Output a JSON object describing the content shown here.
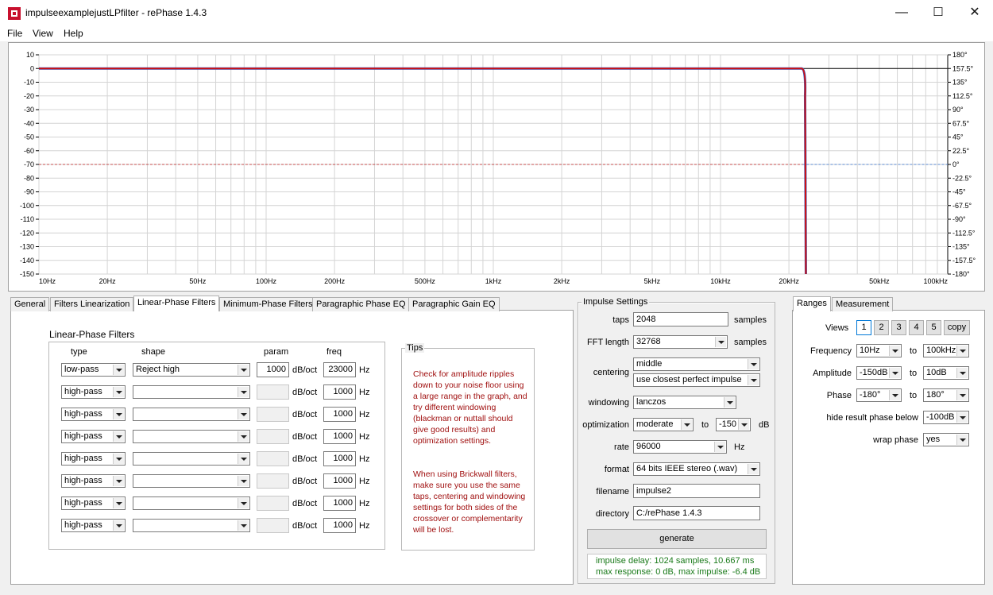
{
  "window": {
    "title": "impulseexamplejustLPfilter  -  rePhase 1.4.3",
    "minimize": "—",
    "maximize": "☐",
    "close": "✕"
  },
  "menu": [
    "File",
    "View",
    "Help"
  ],
  "graph": {
    "y_left_ticks": [
      "10",
      "0",
      "-10",
      "-20",
      "-30",
      "-40",
      "-50",
      "-60",
      "-70",
      "-80",
      "-90",
      "-100",
      "-110",
      "-120",
      "-130",
      "-140",
      "-150"
    ],
    "y_right_ticks": [
      "180°",
      "157.5°",
      "135°",
      "112.5°",
      "90°",
      "67.5°",
      "45°",
      "22.5°",
      "0°",
      "-22.5°",
      "-45°",
      "-67.5°",
      "-90°",
      "-112.5°",
      "-135°",
      "-157.5°",
      "-180°"
    ],
    "x_ticks": [
      "10Hz",
      "20Hz",
      "50Hz",
      "100Hz",
      "200Hz",
      "500Hz",
      "1kHz",
      "2kHz",
      "5kHz",
      "10kHz",
      "20kHz",
      "50kHz",
      "100kHz"
    ],
    "cutoff_hz": 23000,
    "curve_color": "#d01010",
    "phase_color": "#3060d0",
    "threshold_db": -70
  },
  "tabs": [
    "General",
    "Filters Linearization",
    "Linear-Phase Filters",
    "Minimum-Phase Filters",
    "Paragraphic Phase EQ",
    "Paragraphic Gain EQ"
  ],
  "lpf": {
    "heading": "Linear-Phase Filters",
    "col_type": "type",
    "col_shape": "shape",
    "col_param": "param",
    "col_freq": "freq",
    "unit_param": "dB/oct",
    "unit_freq": "Hz",
    "rows": [
      {
        "type": "low-pass",
        "shape": "Reject high",
        "param": "1000",
        "freq": "23000"
      },
      {
        "type": "high-pass",
        "shape": "",
        "param": "",
        "freq": "1000"
      },
      {
        "type": "high-pass",
        "shape": "",
        "param": "",
        "freq": "1000"
      },
      {
        "type": "high-pass",
        "shape": "",
        "param": "",
        "freq": "1000"
      },
      {
        "type": "high-pass",
        "shape": "",
        "param": "",
        "freq": "1000"
      },
      {
        "type": "high-pass",
        "shape": "",
        "param": "",
        "freq": "1000"
      },
      {
        "type": "high-pass",
        "shape": "",
        "param": "",
        "freq": "1000"
      },
      {
        "type": "high-pass",
        "shape": "",
        "param": "",
        "freq": "1000"
      }
    ]
  },
  "tips": {
    "title": "Tips",
    "p1": "Check for amplitude ripples down to your noise floor using a large range in the graph, and try different windowing (blackman or nuttall should give good results) and optimization settings.",
    "p2": "When using Brickwall filters, make sure you use the same taps, centering and windowing settings for both sides of the crossover or complementarity will be lost."
  },
  "impulse": {
    "title": "Impulse Settings",
    "taps_label": "taps",
    "taps_value": "2048",
    "taps_unit": "samples",
    "fft_label": "FFT length",
    "fft_value": "32768",
    "fft_unit": "samples",
    "centering_label": "centering",
    "centering_value": "middle",
    "centering_value2": "use closest perfect impulse",
    "windowing_label": "windowing",
    "windowing_value": "lanczos",
    "optimization_label": "optimization",
    "optimization_value": "moderate",
    "optimization_to": "to",
    "optimization_db": "-150",
    "optimization_unit": "dB",
    "rate_label": "rate",
    "rate_value": "96000",
    "rate_unit": "Hz",
    "format_label": "format",
    "format_value": "64 bits IEEE stereo (.wav)",
    "filename_label": "filename",
    "filename_value": "impulse2",
    "directory_label": "directory",
    "directory_value": "C:/rePhase 1.4.3",
    "generate": "generate",
    "info1": "impulse delay: 1024 samples, 10.667 ms",
    "info2": "max response: 0 dB, max impulse: -6.4 dB"
  },
  "ranges": {
    "tabs": [
      "Ranges",
      "Measurement"
    ],
    "views_label": "Views",
    "views": [
      "1",
      "2",
      "3",
      "4",
      "5"
    ],
    "copy": "copy",
    "frequency_label": "Frequency",
    "freq_from": "10Hz",
    "freq_to": "100kHz",
    "amplitude_label": "Amplitude",
    "amp_from": "-150dB",
    "amp_to": "10dB",
    "phase_label": "Phase",
    "phase_from": "-180°",
    "phase_to": "180°",
    "to": "to",
    "hide_label": "hide result phase below",
    "hide_value": "-100dB",
    "wrap_label": "wrap phase",
    "wrap_value": "yes"
  }
}
